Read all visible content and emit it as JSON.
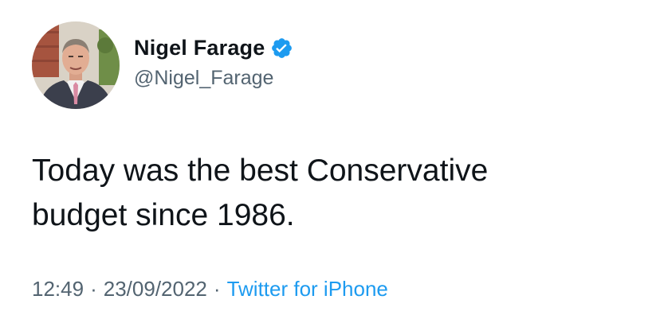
{
  "author": {
    "display_name": "Nigel Farage",
    "handle": "@Nigel_Farage",
    "verified_icon": "verified-badge-icon",
    "verified_color": "#1d9bf0"
  },
  "tweet": {
    "text_lines": [
      "Today was the best Conservative",
      "budget since 1986."
    ]
  },
  "meta": {
    "time": "12:49",
    "separator": "·",
    "date": "23/09/2022",
    "source": "Twitter for iPhone",
    "source_color": "#1d9bf0"
  }
}
